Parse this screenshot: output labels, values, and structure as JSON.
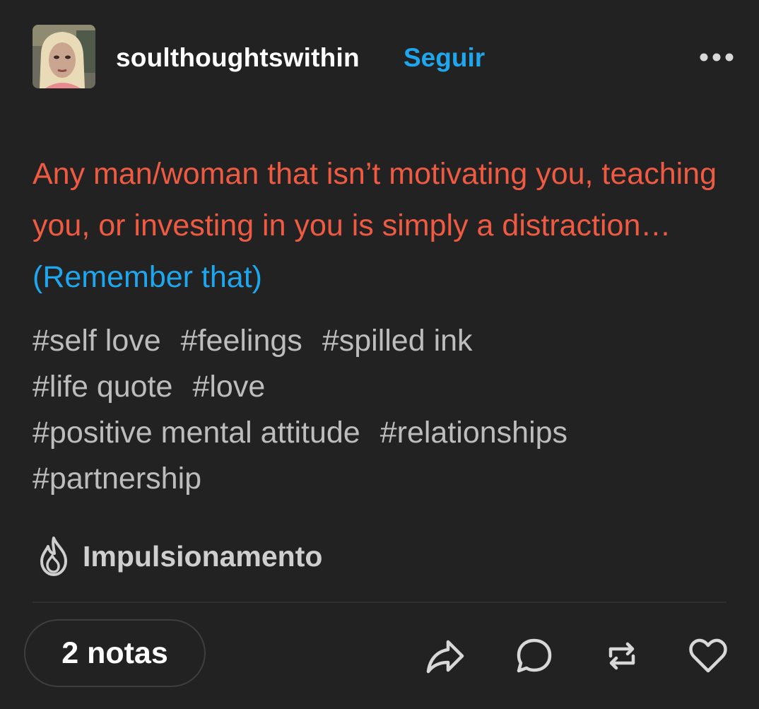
{
  "post": {
    "username": "soulthoughtswithin",
    "follow_label": "Seguir",
    "more_icon": "more-horizontal-icon",
    "body_text": "Any man/woman that isn’t motivating you, teaching you, or investing in you is simply a distraction…",
    "body_link": "(Remember that)",
    "tag_lines": [
      [
        "#self love",
        "#feelings",
        "#spilled ink"
      ],
      [
        "#life quote",
        "#love"
      ],
      [
        "#positive mental attitude",
        "#relationships"
      ],
      [
        "#partnership"
      ]
    ],
    "boost_label": "Impulsionamento",
    "notes_label": "2 notas",
    "actions": [
      "share-icon",
      "reply-icon",
      "reblog-icon",
      "like-icon"
    ]
  },
  "colors": {
    "background": "#222222",
    "body_text": "#ef5a43",
    "link": "#1ea7ee",
    "tags": "#bdbdbd"
  }
}
